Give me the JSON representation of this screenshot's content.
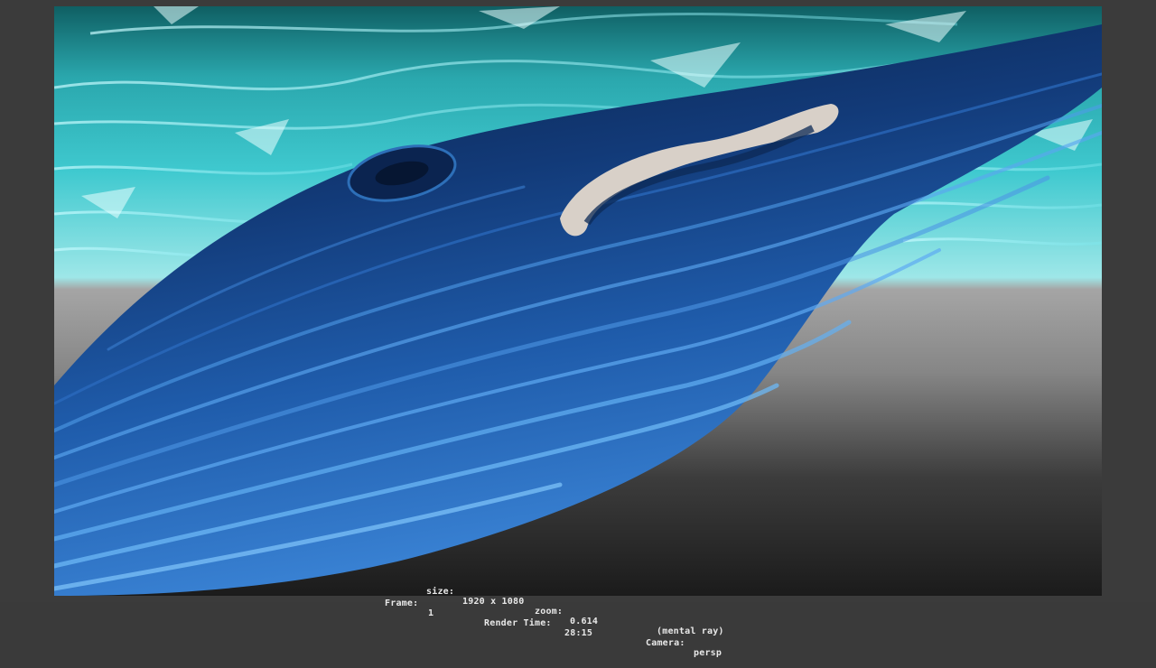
{
  "render_view": {
    "size_label": "size:",
    "size_value": "1920 x 1080",
    "zoom_label": "zoom:",
    "zoom_value": "0.614",
    "renderer": "(mental ray)",
    "frame_label": "Frame:",
    "frame_value": "1",
    "render_time_label": "Render Time:",
    "render_time_value": "28:15",
    "camera_label": "Camera:",
    "camera_value": "persp"
  },
  "colors": {
    "frame_bg": "#3b3b3b",
    "ocean_surface": "#3fc9cf",
    "horizon_gray": "#8e8e8e",
    "floor_dark": "#1f1f1f",
    "whale_dark": "#0c2a55",
    "whale_light": "#3f8be0"
  }
}
